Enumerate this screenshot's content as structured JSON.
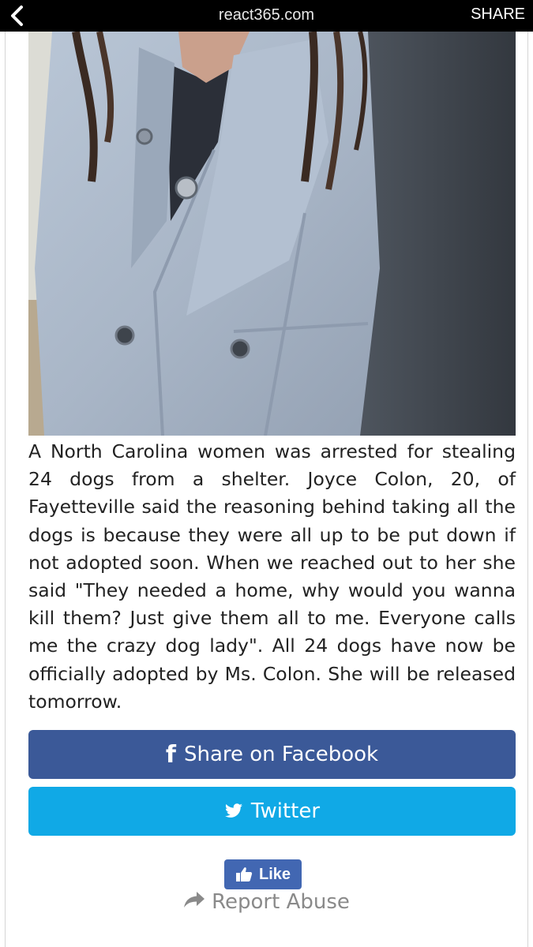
{
  "topbar": {
    "back_icon": "chevron-left-icon",
    "url": "react365.com",
    "share_label": "SHARE"
  },
  "article": {
    "body": "A North Carolina women was arrested for stealing 24 dogs from a shelter. Joyce Colon, 20, of Fayetteville said the reasoning behind taking all the dogs is because they were all up to be put down if not adopted soon. When we reached out to her she said \"They needed a home, why would you wanna kill them? Just give them all to me. Everyone calls me the crazy dog lady\". All 24 dogs have now be officially adopted by Ms. Colon. She will be released tomorrow."
  },
  "share_buttons": {
    "facebook_label": "Share on Facebook",
    "facebook_icon": "facebook-icon",
    "facebook_color": "#3b5998",
    "twitter_label": "Twitter",
    "twitter_icon": "twitter-icon",
    "twitter_color": "#10a9e6"
  },
  "like_button": {
    "label": "Like",
    "icon": "thumbs-up-icon",
    "color": "#4267b2"
  },
  "report": {
    "label": "Report Abuse",
    "icon": "share-arrow-icon"
  }
}
